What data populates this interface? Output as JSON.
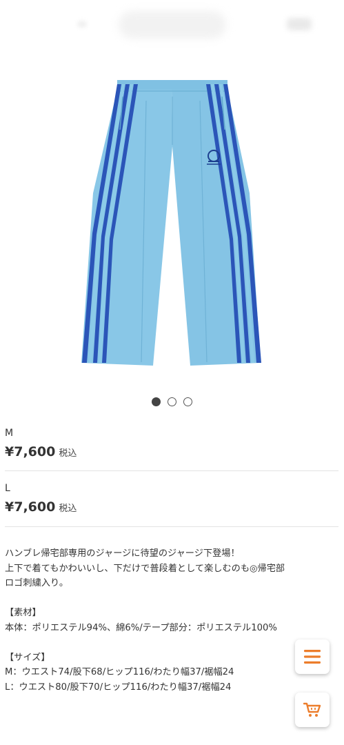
{
  "header": {
    "icons": [
      "blurred-logo",
      "blurred-badge"
    ]
  },
  "product_image": {
    "description_icon": "track-pants-image",
    "colors": {
      "body": "#87c5e6",
      "stripe": "#2b55b8",
      "stripe_light": "#8ccbe8"
    }
  },
  "carousel": {
    "count": 3,
    "active_index": 0
  },
  "variants": [
    {
      "size": "M",
      "price": "¥7,600",
      "tax": "税込"
    },
    {
      "size": "L",
      "price": "¥7,600",
      "tax": "税込"
    }
  ],
  "description": {
    "lines": [
      "ハンブレ帰宅部専用のジャージに待望のジャージ下登場！",
      "上下で着てもかわいいし、下だけで普段着として楽しむのも◎帰宅部",
      "ロゴ刺繍入り。",
      "",
      "【素材】",
      "本体：ポリエステル94%、綿6%/テープ部分：ポリエステル100%",
      "",
      "【サイズ】",
      "M：ウエスト74/股下68/ヒップ116/わたり幅37/裾幅24",
      "L：ウエスト80/股下70/ヒップ116/わたり幅37/裾幅24"
    ]
  },
  "floating_buttons": {
    "menu_icon": "hamburger-menu-icon",
    "cart_icon": "shopping-cart-icon",
    "accent_color": "#ec7d2b"
  }
}
